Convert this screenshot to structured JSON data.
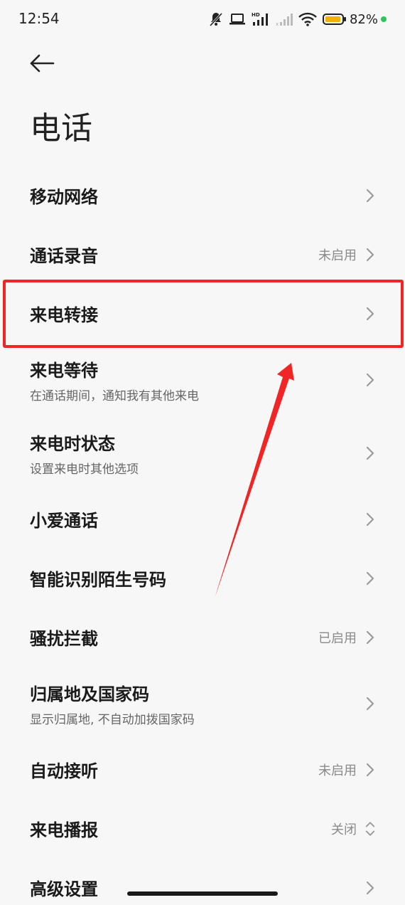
{
  "status": {
    "time": "12:54",
    "battery": "82%",
    "icons": [
      "mute-icon",
      "laptop-icon",
      "hd-signal-icon",
      "signal-icon",
      "wifi-icon",
      "battery-icon"
    ]
  },
  "header": {
    "title": "电话",
    "back_icon": "back-arrow-icon"
  },
  "items": [
    {
      "title": "移动网络",
      "value": "",
      "sub": ""
    },
    {
      "title": "通话录音",
      "value": "未启用",
      "sub": ""
    },
    {
      "title": "来电转接",
      "value": "",
      "sub": ""
    },
    {
      "title": "来电等待",
      "value": "",
      "sub": "在通话期间，通知我有其他来电"
    },
    {
      "title": "来电时状态",
      "value": "",
      "sub": "设置来电时其他选项"
    },
    {
      "title": "小爱通话",
      "value": "",
      "sub": ""
    },
    {
      "title": "智能识别陌生号码",
      "value": "",
      "sub": ""
    },
    {
      "title": "骚扰拦截",
      "value": "已启用",
      "sub": ""
    },
    {
      "title": "归属地及国家码",
      "value": "",
      "sub": "显示归属地, 不自动加拨国家码"
    },
    {
      "title": "自动接听",
      "value": "未启用",
      "sub": ""
    },
    {
      "title": "来电播报",
      "value": "关闭",
      "sub": ""
    },
    {
      "title": "高级设置",
      "value": "",
      "sub": ""
    }
  ],
  "colors": {
    "background": "#f7f7f7",
    "annotation": "#f02525",
    "charge_dot": "#2fc55a",
    "battery_fill": "#f5b100"
  }
}
